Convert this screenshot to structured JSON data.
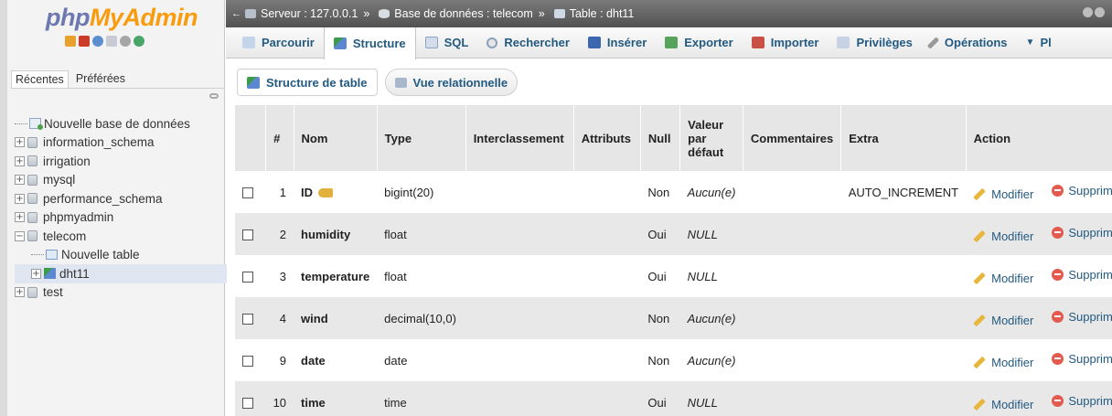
{
  "app": {
    "logo_php": "php",
    "logo_my": "My",
    "logo_admin": "Admin"
  },
  "sidebar": {
    "tabs": [
      "Récentes",
      "Préférées"
    ],
    "tree": [
      {
        "label": "Nouvelle base de données",
        "kind": "new",
        "level": 0
      },
      {
        "label": "information_schema",
        "kind": "db",
        "level": 0
      },
      {
        "label": "irrigation",
        "kind": "db",
        "level": 0
      },
      {
        "label": "mysql",
        "kind": "db",
        "level": 0
      },
      {
        "label": "performance_schema",
        "kind": "db",
        "level": 0
      },
      {
        "label": "phpmyadmin",
        "kind": "db",
        "level": 0
      },
      {
        "label": "telecom",
        "kind": "db-open",
        "level": 0
      },
      {
        "label": "Nouvelle table",
        "kind": "new-table",
        "level": 1
      },
      {
        "label": "dht11",
        "kind": "table",
        "level": 1
      },
      {
        "label": "test",
        "kind": "db",
        "level": 0
      }
    ]
  },
  "breadcrumb": {
    "server": "Serveur : 127.0.0.1",
    "database": "Base de données : telecom",
    "table": "Table : dht11",
    "sep": "»"
  },
  "nav": {
    "tabs": [
      "Parcourir",
      "Structure",
      "SQL",
      "Rechercher",
      "Insérer",
      "Exporter",
      "Importer",
      "Privilèges",
      "Opérations",
      "Pl"
    ],
    "active": "Structure"
  },
  "subtabs": [
    "Structure de table",
    "Vue relationnelle"
  ],
  "grid": {
    "headers": {
      "num": "#",
      "name": "Nom",
      "type": "Type",
      "collation": "Interclassement",
      "attributes": "Attributs",
      "null": "Null",
      "default_1": "Valeur",
      "default_2": "par",
      "default_3": "défaut",
      "comments": "Commentaires",
      "extra": "Extra",
      "action": "Action"
    },
    "rows": [
      {
        "num": "1",
        "name": "ID",
        "type": "bigint(20)",
        "null": "Non",
        "default": "Aucun(e)",
        "extra": "AUTO_INCREMENT",
        "edit": "Modifier",
        "drop": "Supprime",
        "primary": true
      },
      {
        "num": "2",
        "name": "humidity",
        "type": "float",
        "null": "Oui",
        "default": "NULL",
        "extra": "",
        "edit": "Modifier",
        "drop": "Supprime"
      },
      {
        "num": "3",
        "name": "temperature",
        "type": "float",
        "null": "Oui",
        "default": "NULL",
        "extra": "",
        "edit": "Modifier",
        "drop": "Supprime"
      },
      {
        "num": "4",
        "name": "wind",
        "type": "decimal(10,0)",
        "null": "Non",
        "default": "Aucun(e)",
        "extra": "",
        "edit": "Modifier",
        "drop": "Supprime"
      },
      {
        "num": "9",
        "name": "date",
        "type": "date",
        "null": "Non",
        "default": "Aucun(e)",
        "extra": "",
        "edit": "Modifier",
        "drop": "Supprime"
      },
      {
        "num": "10",
        "name": "time",
        "type": "time",
        "null": "Oui",
        "default": "NULL",
        "extra": "",
        "edit": "Modifier",
        "drop": "Supprime"
      }
    ]
  }
}
